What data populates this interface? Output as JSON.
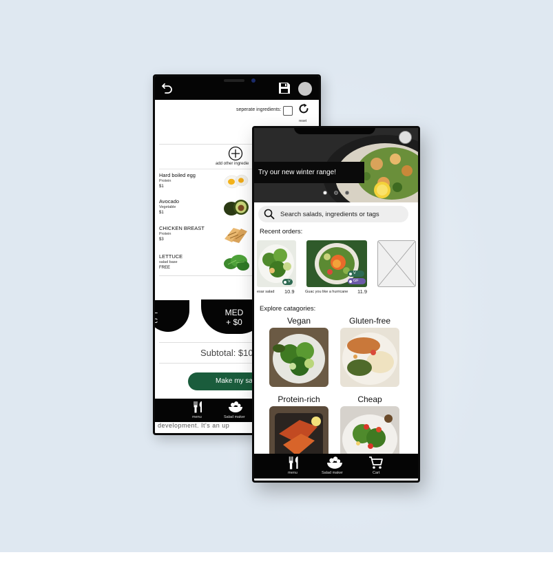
{
  "back_screen": {
    "separate_label": "seperate ingredients:",
    "reset_label": "reset",
    "add_label": "add other ingredie",
    "ingredients": [
      {
        "name": "Hard boiled egg",
        "type": "Protein",
        "price": "$1"
      },
      {
        "name": "Avocado",
        "type": "Vegetable",
        "price": "$1"
      },
      {
        "name": "CHICKEN BREAST",
        "type": "Protein",
        "price": "$3"
      },
      {
        "name": "LETTUCE",
        "type": "salad base",
        "price": "FREE"
      }
    ],
    "bowls": [
      {
        "line1": "L",
        "line2": "0c"
      },
      {
        "line1": "MED",
        "line2": "+ $0"
      }
    ],
    "subtotal": "Subtotal: $10",
    "make_button": "Make my sal",
    "nav": {
      "menu": "menu",
      "salad_maker": "Salad maker"
    },
    "peek_text": "development. It's an up"
  },
  "front_screen": {
    "banner": "Try our new winter range!",
    "search_placeholder": "Search salads, ingredients or tags",
    "recent_heading": "Recent orders:",
    "recent_orders": [
      {
        "name": "esar salad",
        "price": "10.9",
        "tags": [
          "V"
        ]
      },
      {
        "name": "Guac you like a hurricane",
        "price": "11.9",
        "tags": [
          "V",
          "GF"
        ]
      }
    ],
    "explore_heading": "Explore catagories:",
    "categories": [
      {
        "label": "Vegan"
      },
      {
        "label": "Gluten-free"
      },
      {
        "label": "Protein-rich"
      },
      {
        "label": "Cheap"
      }
    ],
    "nav": {
      "menu": "menu",
      "salad_maker": "Salad maker",
      "cart": "Cart"
    }
  },
  "colors": {
    "background": "#dfe8f1",
    "accent_green": "#1a5c3c",
    "tag_vegan": "#2e6a52",
    "tag_gluten_free": "#6b5aa8",
    "bar_black": "#050505"
  }
}
